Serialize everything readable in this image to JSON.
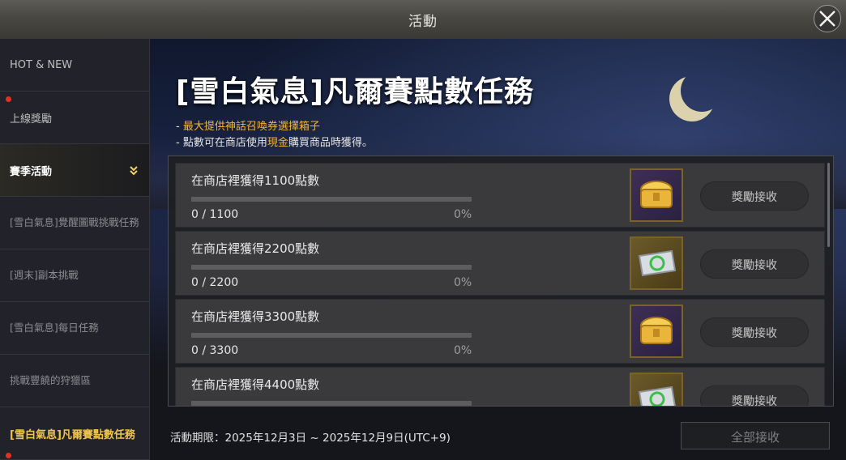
{
  "window": {
    "title": "活動"
  },
  "sidebar": {
    "items": [
      {
        "label": "HOT & NEW"
      },
      {
        "label": "上線獎勵"
      },
      {
        "label": "賽季活動"
      },
      {
        "label": "[雪白氣息]覺醒圖戰挑戰任務"
      },
      {
        "label": "[週末]副本挑戰"
      },
      {
        "label": "[雪白氣息]每日任務"
      },
      {
        "label": "挑戰豐饒的狩獵區"
      },
      {
        "label": "[雪白氣息]凡爾賽點數任務"
      }
    ]
  },
  "event": {
    "title": "[雪白氣息]凡爾賽點數任務",
    "note1_prefix": "- ",
    "note1_highlight": "最大提供神話召喚券選擇箱子",
    "note2_prefix": "- 點數可在商店使用",
    "note2_highlight": "現金",
    "note2_suffix": "購買商品時獲得。",
    "highlight_color": "#f3b43a"
  },
  "missions": [
    {
      "label": "在商店裡獲得1100點數",
      "count": "0 / 1100",
      "percent": "0%",
      "progress": 0,
      "reward_icon": "gold-chest-icon",
      "claim_label": "獎勵接收"
    },
    {
      "label": "在商店裡獲得2200點數",
      "count": "0 / 2200",
      "percent": "0%",
      "progress": 0,
      "reward_icon": "summon-ticket-icon",
      "claim_label": "獎勵接收"
    },
    {
      "label": "在商店裡獲得3300點數",
      "count": "0 / 3300",
      "percent": "0%",
      "progress": 0,
      "reward_icon": "gold-chest-icon",
      "claim_label": "獎勵接收"
    },
    {
      "label": "在商店裡獲得4400點數",
      "count": "",
      "percent": "",
      "progress": 0,
      "reward_icon": "summon-ticket-icon",
      "claim_label": "獎勵接收"
    }
  ],
  "footer": {
    "period": "活動期限：2025年12月3日 ~ 2025年12月9日(UTC+9)",
    "claim_all_label": "全部接收"
  }
}
